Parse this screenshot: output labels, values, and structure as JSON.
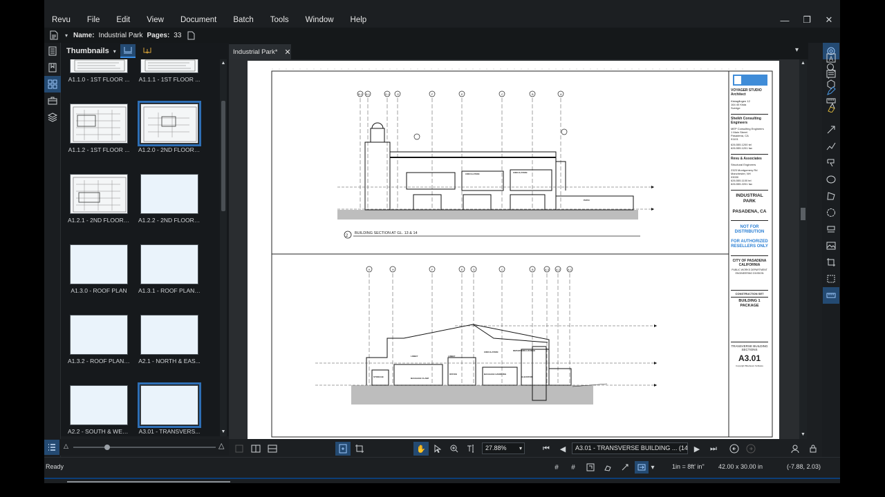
{
  "menu": [
    "Revu",
    "File",
    "Edit",
    "View",
    "Document",
    "Batch",
    "Tools",
    "Window",
    "Help"
  ],
  "window_controls": {
    "minimize": "—",
    "restore": "❐",
    "close": "✕"
  },
  "docbar": {
    "name_label": "Name:",
    "name_value": "Industrial Park",
    "pages_label": "Pages:",
    "pages_value": "33"
  },
  "thumbnails": {
    "title": "Thumbnails",
    "items": [
      {
        "label": "A1.1.0 - 1ST FLOOR ...",
        "drawn": true
      },
      {
        "label": "A1.1.1 - 1ST FLOOR ...",
        "drawn": true
      },
      {
        "label": "A1.1.2 - 1ST FLOOR ...",
        "drawn": true
      },
      {
        "label": "A1.2.0 - 2ND FLOOR ...",
        "drawn": true,
        "selected": true
      },
      {
        "label": "A1.2.1 - 2ND FLOOR ...",
        "drawn": true
      },
      {
        "label": "A1.2.2 - 2ND FLOOR ...",
        "drawn": false
      },
      {
        "label": "A1.3.0 - ROOF PLAN",
        "drawn": false
      },
      {
        "label": "A1.3.1 - ROOF PLAN ...",
        "drawn": false
      },
      {
        "label": "A1.3.2 - ROOF PLAN ...",
        "drawn": false
      },
      {
        "label": "A2.1 - NORTH & EAS...",
        "drawn": false
      },
      {
        "label": "A2.2 - SOUTH & WES...",
        "drawn": false
      },
      {
        "label": "A3.01 - TRANSVERS...",
        "drawn": false,
        "selected": true
      }
    ]
  },
  "tab": {
    "label": "Industrial Park*",
    "close": "✕"
  },
  "drawing": {
    "section1_label": "BUILDING SECTION AT GL. 13 & 14",
    "section1_num": "2",
    "grid_top": [
      "B.2",
      "B.1",
      "D.1",
      "G",
      "F",
      "E",
      "C",
      "B",
      "A"
    ],
    "grid_bottom": [
      "K",
      "H",
      "F",
      "E",
      "D",
      "C",
      "B",
      "A.3",
      "A.2",
      "A.1"
    ],
    "room_labels": [
      "CIRCULATION",
      "CIRCULATION",
      "LOBBY",
      "LOBBY",
      "CIRCULATION",
      "DEPARTURE LOUNGE",
      "STORAGE",
      "BAGGAGE CLAIM",
      "OFFICE",
      "BAGGAGE HANDLING",
      "ELEVATOR",
      "PATIO"
    ],
    "titleblock": {
      "firm1": "VOYAGER STUDIO Architect",
      "firm1_addr": "Kistagången 12\n164 40 Kista\nSverige",
      "firm2": "Sheikh Consulting Engineers",
      "firm2_addr": "MEP Consulting Engineers\n1 Main Street\nPasadena, CA\n91101",
      "firm2_phone": "626.555.1200 tel\n626.555.1201 fax",
      "firm3": "Revu & Associates",
      "firm3_sub": "Structural Engineers",
      "firm3_addr": "2323 Montgomery Rd\nManchester, NH\n03030\n626.555.1100 tel\n626.555.2201 fax",
      "project": "INDUSTRIAL PARK",
      "city": "PASADENA, CA",
      "notice1": "NOT FOR DISTRIBUTION",
      "notice2": "FOR AUTHORIZED RESELLERS ONLY",
      "owner": "CITY OF PASADENA CALIFORNIA",
      "owner_dept": "PUBLIC WORKS DEPARTMENT\nENGINEERING DIVISION",
      "set": "CONSTRUCTION SET",
      "package": "BUILDING 1 PACKAGE",
      "sheet_title": "TRANSVERSE BUILDING SECTIONS",
      "sheet_no": "A3.01",
      "copyright": "Copyright Bluebeam Software"
    }
  },
  "navbar": {
    "zoom": "27.88%",
    "page": "A3.01 - TRANSVERSE BUILDING ... (14 of 33)"
  },
  "status": {
    "ready": "Ready",
    "scale": "1in = 8ft' in\"",
    "size": "42.00 x 30.00 in",
    "coords": "(-7.88, 2.03)"
  },
  "colors": {
    "accent": "#244a72",
    "highlight": "#3a8ee6",
    "notice": "#2a7fd4"
  }
}
